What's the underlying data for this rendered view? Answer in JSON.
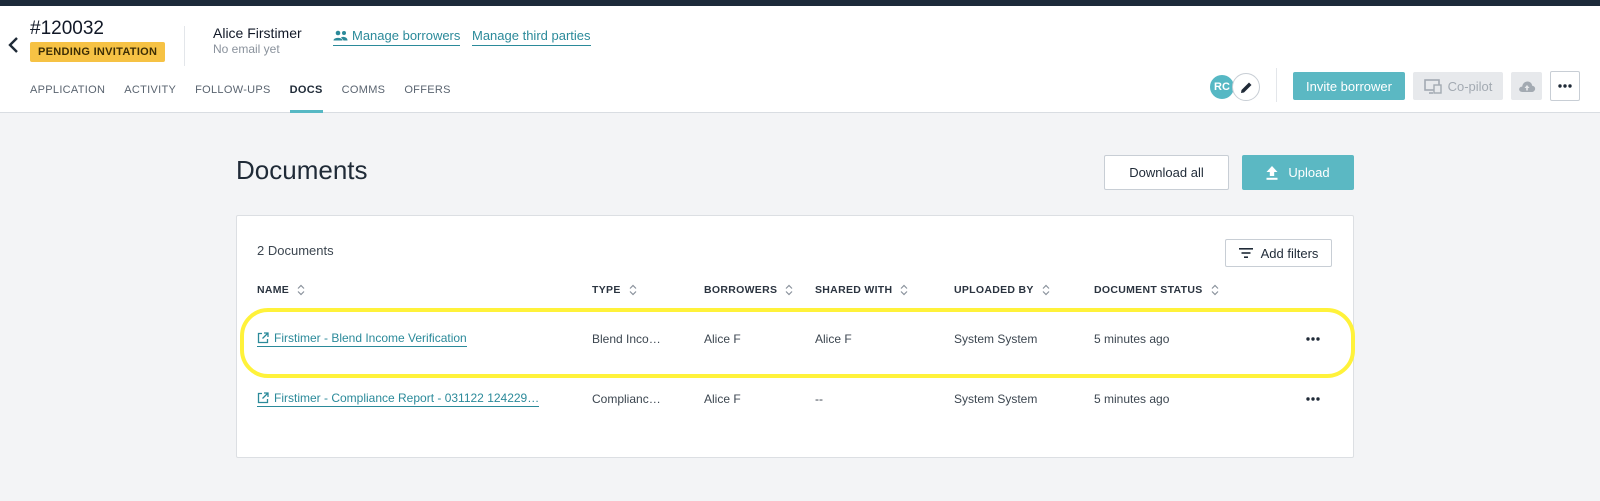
{
  "header": {
    "loan_id": "#120032",
    "status_badge": "PENDING INVITATION",
    "borrower_name": "Alice Firstimer",
    "borrower_email": "No email yet",
    "manage_borrowers": "Manage borrowers",
    "manage_third_parties": "Manage third parties",
    "avatar_initials": "RC",
    "invite_label": "Invite borrower",
    "copilot_label": "Co-pilot"
  },
  "tabs": [
    {
      "label": "APPLICATION",
      "active": false
    },
    {
      "label": "ACTIVITY",
      "active": false
    },
    {
      "label": "FOLLOW-UPS",
      "active": false
    },
    {
      "label": "DOCS",
      "active": true
    },
    {
      "label": "COMMS",
      "active": false
    },
    {
      "label": "OFFERS",
      "active": false
    }
  ],
  "page": {
    "title": "Documents",
    "download_all": "Download all",
    "upload": "Upload"
  },
  "table": {
    "count": "2 Documents",
    "add_filters": "Add filters",
    "columns": [
      "NAME",
      "TYPE",
      "BORROWERS",
      "SHARED WITH",
      "UPLOADED BY",
      "DOCUMENT STATUS"
    ],
    "rows": [
      {
        "name": "Firstimer - Blend Income Verification",
        "type": "Blend Inco…",
        "borrowers": "Alice F",
        "shared_with": "Alice F",
        "uploaded_by": "System System",
        "status": "5 minutes ago"
      },
      {
        "name": "Firstimer - Compliance Report - 031122 124229…",
        "type": "Complianc…",
        "borrowers": "Alice F",
        "shared_with": "--",
        "uploaded_by": "System System",
        "status": "5 minutes ago"
      }
    ]
  },
  "colors": {
    "accent": "#5bb8c3",
    "link": "#2b8a9a",
    "badge": "#f6c244",
    "highlight": "#fff23a"
  }
}
